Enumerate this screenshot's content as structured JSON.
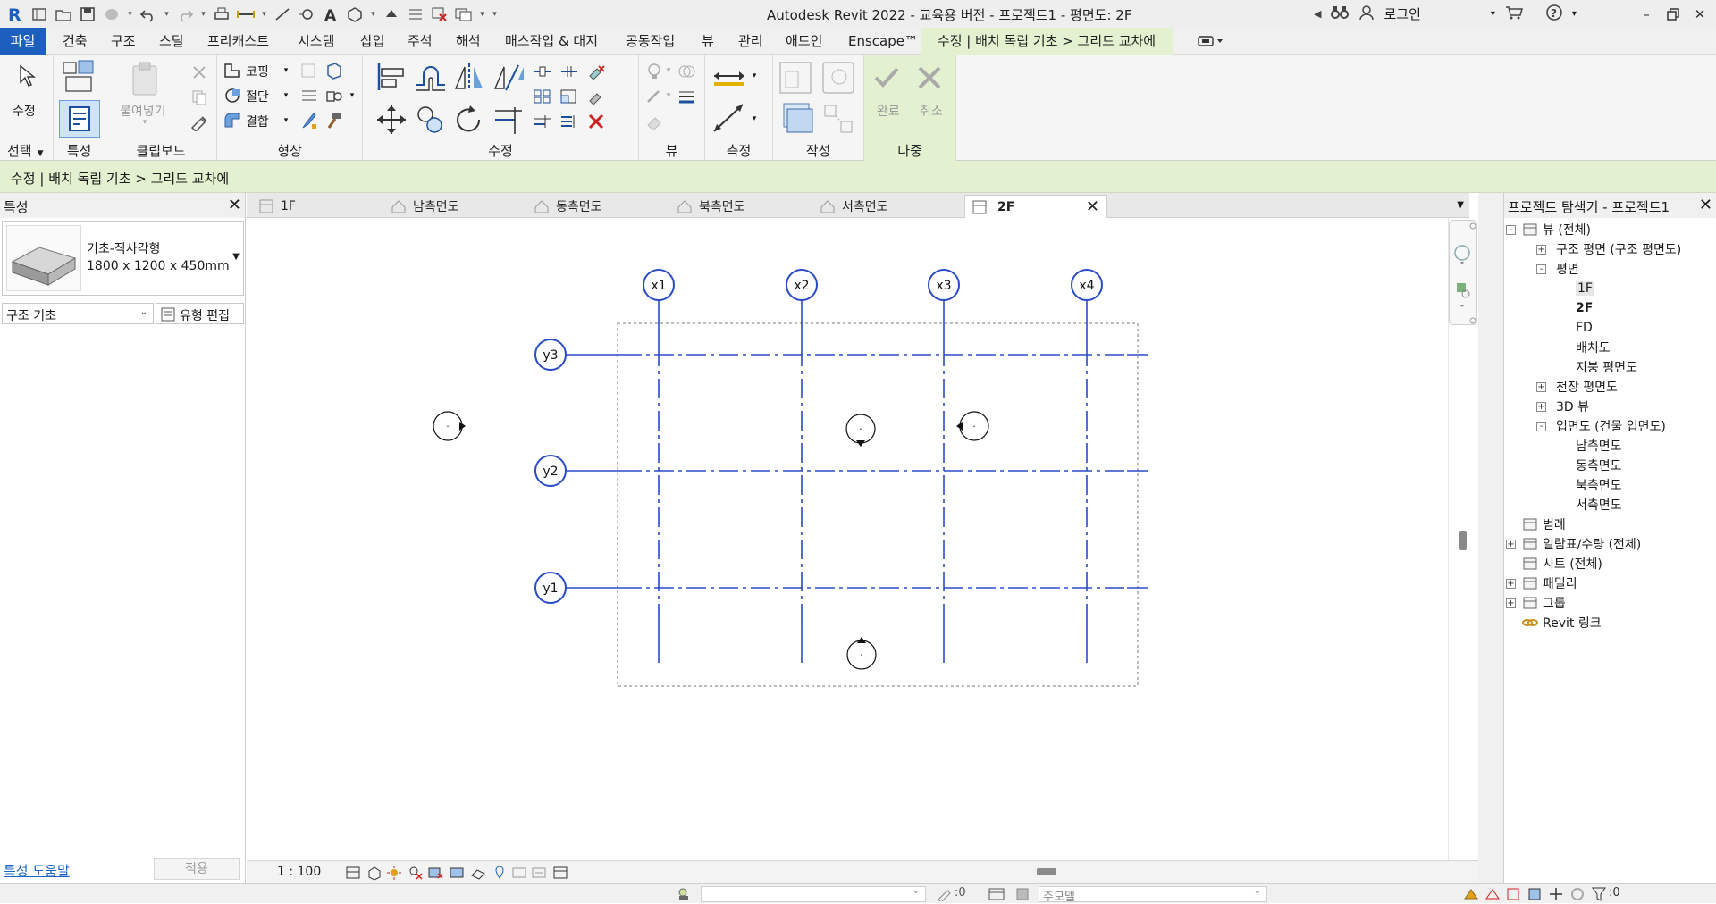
{
  "window": {
    "title": "Autodesk Revit 2022 - 교육용 버전 - 프로젝트1 - 평면도: 2F",
    "login_label": "로그인"
  },
  "menu": {
    "tabs": [
      "파일",
      "건축",
      "구조",
      "스틸",
      "프리캐스트",
      "시스템",
      "삽입",
      "주석",
      "해석",
      "매스작업 & 대지",
      "공동작업",
      "뷰",
      "관리",
      "애드인",
      "Enscape™"
    ],
    "context_tab": "수정 | 배치 독립 기초 > 그리드 교차에"
  },
  "ribbon": {
    "panels": {
      "select": "선택",
      "properties": "특성",
      "clipboard": "클립보드",
      "geometry": "형상",
      "modify": "수정",
      "view": "뷰",
      "measure": "측정",
      "create": "작성",
      "multiple": "다중"
    },
    "tools": {
      "modify": "수정",
      "paste": "붙여넣기",
      "cope": "코핑",
      "cut": "절단",
      "join": "결합",
      "finish": "완료",
      "cancel": "취소"
    }
  },
  "options_bar": {
    "text": "수정 | 배치 독립 기초 > 그리드 교차에"
  },
  "properties": {
    "header": "특성",
    "type_name": "기초-직사각형",
    "type_size": "1800 x 1200 x 450mm",
    "category": "구조 기초",
    "edit_type": "유형 편집",
    "help_link": "특성 도움말",
    "apply": "적용"
  },
  "view_tabs": [
    {
      "label": "1F",
      "icon": "floor-plan-icon"
    },
    {
      "label": "남측면도",
      "icon": "elevation-icon"
    },
    {
      "label": "동측면도",
      "icon": "elevation-icon"
    },
    {
      "label": "북측면도",
      "icon": "elevation-icon"
    },
    {
      "label": "서측면도",
      "icon": "elevation-icon"
    },
    {
      "label": "2F",
      "icon": "floor-plan-icon",
      "active": true
    }
  ],
  "canvas": {
    "grid_x": [
      "x1",
      "x2",
      "x3",
      "x4"
    ],
    "grid_y": [
      "y3",
      "y2",
      "y1"
    ],
    "grid_color": "#2a4bc8",
    "elevation_marker_label": "·"
  },
  "view_control": {
    "scale": "1 : 100"
  },
  "project_browser": {
    "header": "프로젝트 탐색기 - 프로젝트1",
    "tree": [
      {
        "label": "뷰 (전체)",
        "level": 0,
        "exp": "-",
        "icon": "views-icon"
      },
      {
        "label": "구조 평면 (구조 평면도)",
        "level": 1,
        "exp": "+"
      },
      {
        "label": "평면",
        "level": 1,
        "exp": "-"
      },
      {
        "label": "1F",
        "level": 2,
        "selected": true
      },
      {
        "label": "2F",
        "level": 2,
        "bold": true
      },
      {
        "label": "FD",
        "level": 2
      },
      {
        "label": "배치도",
        "level": 2
      },
      {
        "label": "지붕 평면도",
        "level": 2
      },
      {
        "label": "천장 평면도",
        "level": 1,
        "exp": "+"
      },
      {
        "label": "3D 뷰",
        "level": 1,
        "exp": "+"
      },
      {
        "label": "입면도 (건물 입면도)",
        "level": 1,
        "exp": "-"
      },
      {
        "label": "남측면도",
        "level": 2
      },
      {
        "label": "동측면도",
        "level": 2
      },
      {
        "label": "북측면도",
        "level": 2
      },
      {
        "label": "서측면도",
        "level": 2
      },
      {
        "label": "범례",
        "level": 0,
        "icon": "legend-icon"
      },
      {
        "label": "일람표/수량 (전체)",
        "level": 0,
        "exp": "+",
        "icon": "schedule-icon"
      },
      {
        "label": "시트 (전체)",
        "level": 0,
        "icon": "sheet-icon"
      },
      {
        "label": "패밀리",
        "level": 0,
        "exp": "+",
        "icon": "family-icon"
      },
      {
        "label": "그룹",
        "level": 0,
        "exp": "+",
        "icon": "group-icon"
      },
      {
        "label": "Revit 링크",
        "level": 0,
        "icon": "revit-link-icon"
      }
    ]
  },
  "status_bar": {
    "worksets_count": ":0",
    "model_label": "주모델",
    "filter_count": ":0"
  },
  "colors": {
    "accent": "#1d5fbf",
    "context_green": "#e3f1d0"
  }
}
